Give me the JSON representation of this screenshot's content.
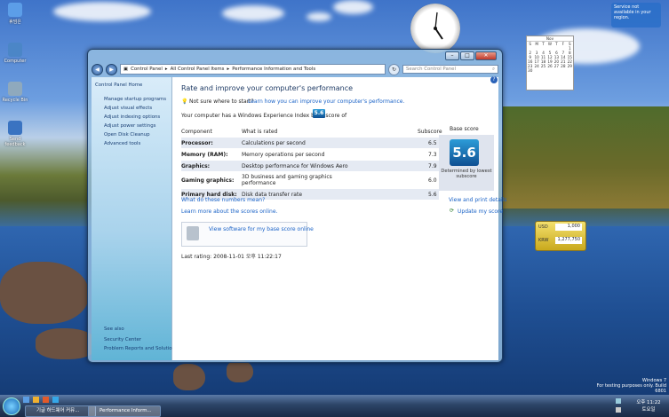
{
  "desktop": {
    "icons": [
      {
        "label": "휴덤은",
        "color": "#5c9ee8"
      },
      {
        "label": "Computer",
        "color": "#4b86c7"
      },
      {
        "label": "Recycle Bin",
        "color": "#8fa9bd"
      },
      {
        "label": "Send feedback",
        "color": "#3a73c1"
      }
    ],
    "notification": "Service not available in your region.",
    "calendar": {
      "month": "Nov",
      "days": [
        "1",
        "2",
        "3",
        "4",
        "5",
        "6",
        "7",
        "8",
        "9",
        "10",
        "11",
        "12",
        "13",
        "14",
        "15",
        "16",
        "17",
        "18",
        "19",
        "20",
        "21",
        "22",
        "23",
        "24",
        "25",
        "26",
        "27",
        "28",
        "29",
        "30"
      ],
      "weekdays": [
        "S",
        "M",
        "T",
        "W",
        "T",
        "F",
        "S"
      ]
    },
    "currency": {
      "usd_label": "USD",
      "usd_value": "1,000",
      "krw_label": "KRW",
      "krw_value": "1,277,750"
    },
    "watermark": {
      "line1": "Windows 7",
      "line2": "For testing purposes only. Build 6801"
    }
  },
  "window": {
    "caption": {
      "minimize": "–",
      "maximize": "□",
      "close": "✕"
    },
    "breadcrumb": [
      "Control Panel",
      "All Control Panel Items",
      "Performance Information and Tools"
    ],
    "search_placeholder": "Search Control Panel",
    "sidebar": {
      "home": "Control Panel Home",
      "items": [
        "Manage startup programs",
        "Adjust visual effects",
        "Adjust indexing options",
        "Adjust power settings",
        "Open Disk Cleanup",
        "Advanced tools"
      ],
      "see_also_title": "See also",
      "see_also": [
        "Security Center",
        "Problem Reports and Solutions"
      ]
    },
    "content": {
      "title": "Rate and improve your computer's performance",
      "not_sure": "Not sure where to start?",
      "learn_link": "Learn how you can improve your computer's performance.",
      "index_text": "Your computer has a Windows Experience Index base score of",
      "index_score": "5.6",
      "headers": {
        "component": "Component",
        "rated": "What is rated",
        "subscore": "Subscore",
        "base": "Base score"
      },
      "rows": [
        {
          "component": "Processor:",
          "rated": "Calculations per second",
          "subscore": "6.5"
        },
        {
          "component": "Memory (RAM):",
          "rated": "Memory operations per second",
          "subscore": "7.3"
        },
        {
          "component": "Graphics:",
          "rated": "Desktop performance for Windows Aero",
          "subscore": "7.9"
        },
        {
          "component": "Gaming graphics:",
          "rated": "3D business and gaming graphics performance",
          "subscore": "6.0"
        },
        {
          "component": "Primary hard disk:",
          "rated": "Disk data transfer rate",
          "subscore": "5.6"
        }
      ],
      "base_score": "5.6",
      "base_label": "Determined by lowest subscore",
      "what_numbers": "What do these numbers mean?",
      "view_print": "View and print details",
      "learn_online": "Learn more about the scores online.",
      "update": "Update my score",
      "view_software": "View software for my base score online",
      "last_rating": "Last rating: 2008-11-01 오후 11:22:17"
    }
  },
  "taskbar": {
    "tasks": [
      "기글 하드웨어 커뮤...",
      "Performance Inform..."
    ],
    "time": "오후 11:22",
    "day": "토요일"
  }
}
